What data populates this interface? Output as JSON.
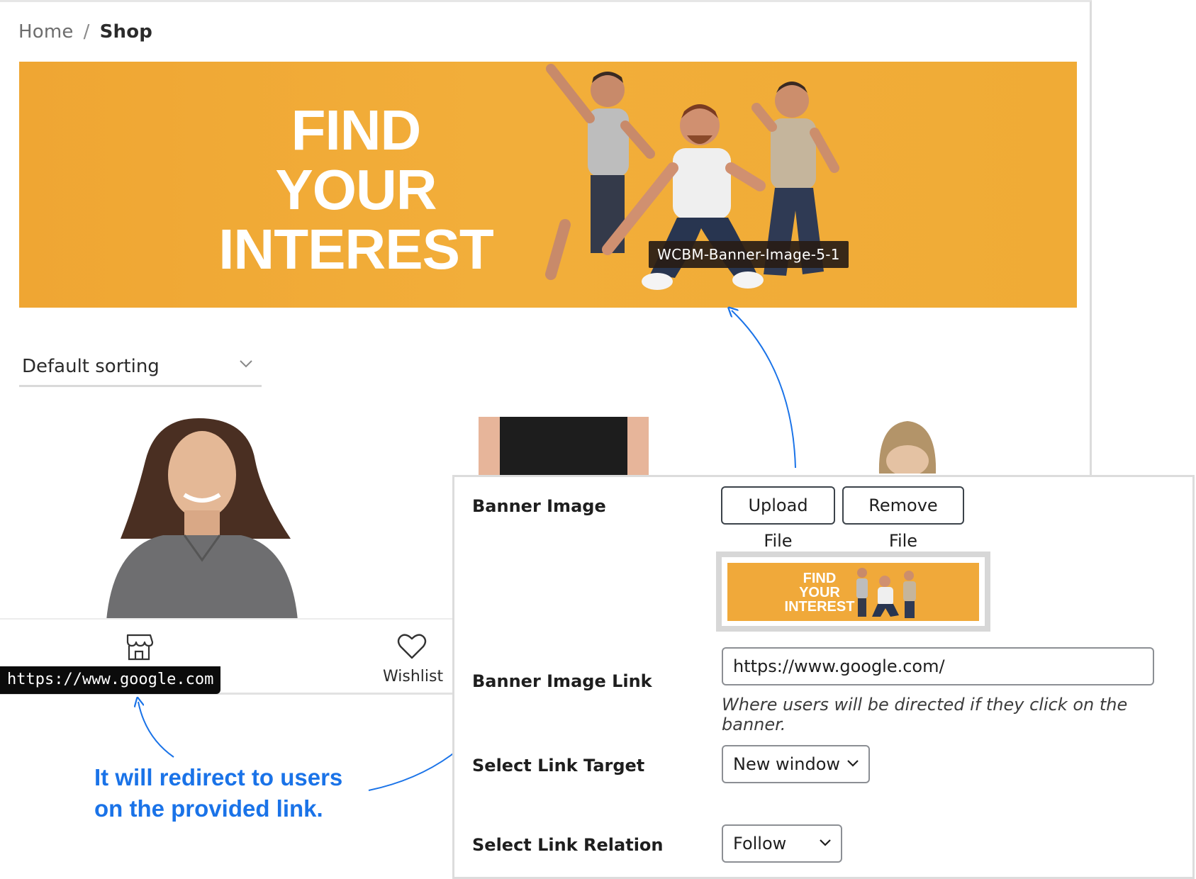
{
  "breadcrumb": {
    "home": "Home",
    "separator": "/",
    "current": "Shop"
  },
  "banner": {
    "headline_lines": [
      "FIND",
      "YOUR",
      "INTEREST"
    ],
    "tooltip": "WCBM-Banner-Image-5-1",
    "background_color": "#f0a936"
  },
  "sorting": {
    "selected": "Default sorting",
    "icon": "chevron-down-icon"
  },
  "action_bar": {
    "store_icon": "store-icon",
    "wishlist_icon": "heart-icon",
    "wishlist_label": "Wishlist",
    "hover_url": "https://www.google.com"
  },
  "annotation": {
    "line1": "It will redirect to users",
    "line2": "on the provided link.",
    "color": "#1a73e8"
  },
  "settings": {
    "banner_image_label": "Banner Image",
    "upload_button": "Upload File",
    "remove_button": "Remove File",
    "thumbnail_text_lines": [
      "FIND",
      "YOUR",
      "INTEREST"
    ],
    "banner_link_label": "Banner Image Link",
    "banner_link_value": "https://www.google.com/",
    "banner_link_help": "Where users will be directed if they click on the banner.",
    "link_target_label": "Select Link Target",
    "link_target_value": "New window",
    "link_relation_label": "Select Link Relation",
    "link_relation_value": "Follow"
  }
}
